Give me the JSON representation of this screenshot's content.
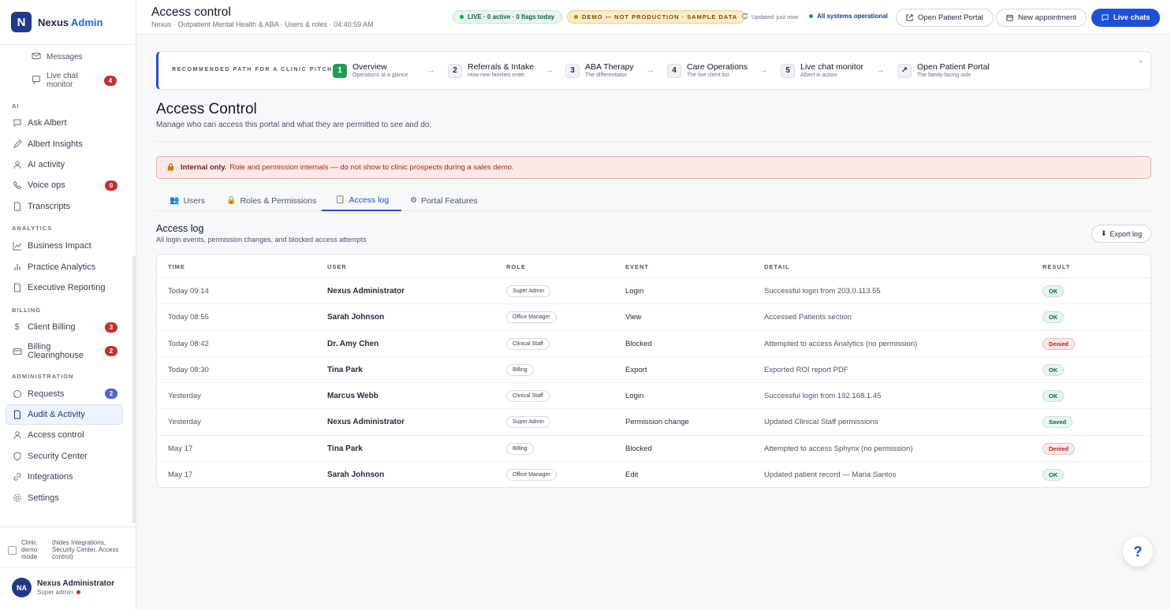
{
  "brand": {
    "logo_letter": "N",
    "name": "Nexus",
    "accent": "Admin"
  },
  "sidebar": {
    "top_items": [
      {
        "label": "Messages",
        "icon": "mail-icon"
      },
      {
        "label": "Live chat monitor",
        "icon": "chat-icon",
        "badge": "4"
      }
    ],
    "sections": {
      "ai": "AI",
      "analytics": "ANALYTICS",
      "billing": "BILLING",
      "administration": "ADMINISTRATION"
    },
    "ai_items": [
      {
        "label": "Ask Albert",
        "icon": "chat-icon"
      },
      {
        "label": "Albert Insights",
        "icon": "pen-icon"
      },
      {
        "label": "AI activity",
        "icon": "user-icon"
      },
      {
        "label": "Voice ops",
        "icon": "phone-icon",
        "badge": "0"
      },
      {
        "label": "Transcripts",
        "icon": "document-icon"
      }
    ],
    "analytics_items": [
      {
        "label": "Business Impact",
        "icon": "trend-icon"
      },
      {
        "label": "Practice Analytics",
        "icon": "bar-chart-icon"
      },
      {
        "label": "Executive Reporting",
        "icon": "document-icon"
      }
    ],
    "billing_items": [
      {
        "label": "Client Billing",
        "icon": "dollar-icon",
        "badge": "3"
      },
      {
        "label": "Billing Clearinghouse",
        "icon": "card-icon",
        "badge": "2"
      }
    ],
    "admin_items": [
      {
        "label": "Requests",
        "icon": "chat-icon",
        "badge": "2"
      },
      {
        "label": "Audit & Activity",
        "icon": "document-icon"
      },
      {
        "label": "Access control",
        "icon": "user-icon"
      },
      {
        "label": "Security Center",
        "icon": "shield-icon"
      },
      {
        "label": "Integrations",
        "icon": "link-icon"
      },
      {
        "label": "Settings",
        "icon": "gear-icon"
      }
    ],
    "demo_mode_label": "Clinic demo mode",
    "demo_mode_hint": "(hides Integrations, Security Center, Access control)",
    "user": {
      "initials": "NA",
      "name": "Nexus Administrator",
      "role": "Super admin"
    }
  },
  "header": {
    "title": "Access control",
    "subtitle": "Nexus · Outpatient Mental Health & ABA · Users & roles · 04:40:59 AM",
    "live_pill": "LIVE · 0 active · 0 flags today",
    "demo_pill": "DEMO — NOT PRODUCTION · SAMPLE DATA",
    "updated_label": "Updated",
    "updated_value": "just now",
    "system_status": "All systems operational",
    "btn_portal": "Open Patient Portal",
    "btn_appointment": "New appointment",
    "btn_chats": "Live chats"
  },
  "pitch": {
    "label": "RECOMMENDED PATH FOR A CLINIC PITCH",
    "close": "×",
    "steps": [
      {
        "num": "1",
        "title": "Overview",
        "desc": "Operations at a glance"
      },
      {
        "num": "2",
        "title": "Referrals & Intake",
        "desc": "How new families enter"
      },
      {
        "num": "3",
        "title": "ABA Therapy",
        "desc": "The differentiator"
      },
      {
        "num": "4",
        "title": "Care Operations",
        "desc": "The live client list"
      },
      {
        "num": "5",
        "title": "Live chat monitor",
        "desc": "Albert in action"
      },
      {
        "num": "↗",
        "title": "Open Patient Portal",
        "desc": "The family-facing side"
      }
    ],
    "arrow": "→"
  },
  "page": {
    "title": "Access Control",
    "subtitle": "Manage who can access this portal and what they are permitted to see and do.",
    "warning_strong": "Internal only.",
    "warning_text": "Role and permission internals — do not show to clinic prospects during a sales demo."
  },
  "tabs": [
    {
      "label": "Users",
      "icon": "👥"
    },
    {
      "label": "Roles & Permissions",
      "icon": "🔒"
    },
    {
      "label": "Access log",
      "icon": "📋"
    },
    {
      "label": "Portal Features",
      "icon": "⚙"
    }
  ],
  "log": {
    "title": "Access log",
    "subtitle": "All login events, permission changes, and blocked access attempts",
    "export_label": "Export log",
    "export_icon": "⬇",
    "columns": [
      "TIME",
      "USER",
      "ROLE",
      "EVENT",
      "DETAIL",
      "RESULT"
    ],
    "rows": [
      {
        "time": "Today 09:14",
        "user": "Nexus Administrator",
        "role": "Super Admin",
        "event": "Login",
        "detail": "Successful login from 203.0.113.55",
        "result": "OK",
        "status": "ok"
      },
      {
        "time": "Today 08:55",
        "user": "Sarah Johnson",
        "role": "Office Manager",
        "event": "View",
        "detail": "Accessed Patients section",
        "result": "OK",
        "status": "ok"
      },
      {
        "time": "Today 08:42",
        "user": "Dr. Amy Chen",
        "role": "Clinical Staff",
        "event": "Blocked",
        "detail": "Attempted to access Analytics (no permission)",
        "result": "Denied",
        "status": "denied"
      },
      {
        "time": "Today 08:30",
        "user": "Tina Park",
        "role": "Billing",
        "event": "Export",
        "detail": "Exported ROI report PDF",
        "result": "OK",
        "status": "ok"
      },
      {
        "time": "Yesterday",
        "user": "Marcus Webb",
        "role": "Clinical Staff",
        "event": "Login",
        "detail": "Successful login from 192.168.1.45",
        "result": "OK",
        "status": "ok"
      },
      {
        "time": "Yesterday",
        "user": "Nexus Administrator",
        "role": "Super Admin",
        "event": "Permission change",
        "detail": "Updated Clinical Staff permissions",
        "result": "Saved",
        "status": "saved"
      },
      {
        "time": "May 17",
        "user": "Tina Park",
        "role": "Billing",
        "event": "Blocked",
        "detail": "Attempted to access Sphynx (no permission)",
        "result": "Denied",
        "status": "denied"
      },
      {
        "time": "May 17",
        "user": "Sarah Johnson",
        "role": "Office Manager",
        "event": "Edit",
        "detail": "Updated patient record — Maria Santos",
        "result": "OK",
        "status": "ok"
      }
    ]
  },
  "help_fab": "?"
}
